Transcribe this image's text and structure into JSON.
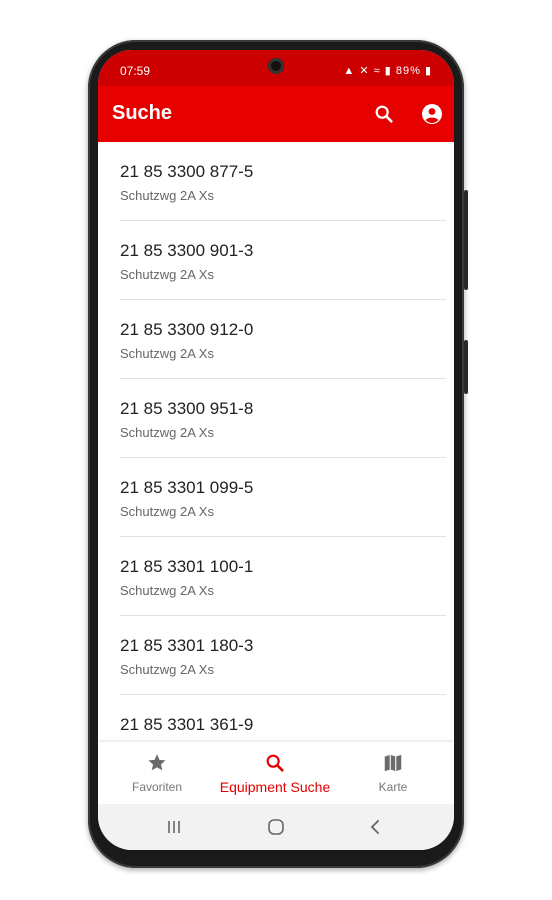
{
  "status_bar": {
    "time": "07:59",
    "battery": "89%",
    "icons": [
      "battery-saver-icon",
      "mute-icon",
      "wifi-icon",
      "signal-icon",
      "battery-icon"
    ]
  },
  "app_bar": {
    "title": "Suche",
    "actions": [
      "search-icon",
      "account-icon"
    ]
  },
  "list": {
    "items": [
      {
        "title": "21 85 3300 877-5",
        "subtitle": "Schutzwg 2A Xs"
      },
      {
        "title": "21 85 3300 901-3",
        "subtitle": "Schutzwg 2A Xs"
      },
      {
        "title": "21 85 3300 912-0",
        "subtitle": "Schutzwg 2A Xs"
      },
      {
        "title": "21 85 3300 951-8",
        "subtitle": "Schutzwg 2A Xs"
      },
      {
        "title": "21 85 3301 099-5",
        "subtitle": "Schutzwg 2A Xs"
      },
      {
        "title": "21 85 3301 100-1",
        "subtitle": "Schutzwg 2A Xs"
      },
      {
        "title": "21 85 3301 180-3",
        "subtitle": "Schutzwg 2A Xs"
      },
      {
        "title": "21 85 3301 361-9",
        "subtitle": ""
      }
    ]
  },
  "bottom_nav": {
    "items": [
      {
        "label": "Favoriten",
        "icon": "star-icon",
        "active": false
      },
      {
        "label": "Equipment Suche",
        "icon": "search-icon",
        "active": true
      },
      {
        "label": "Karte",
        "icon": "map-icon",
        "active": false
      }
    ]
  },
  "system_nav": [
    "recents-icon",
    "home-icon",
    "back-icon"
  ],
  "colors": {
    "accent": "#e60000",
    "status_bar": "#cc0000",
    "text_primary": "#222222",
    "text_secondary": "#666666",
    "nav_inactive": "#777777"
  }
}
